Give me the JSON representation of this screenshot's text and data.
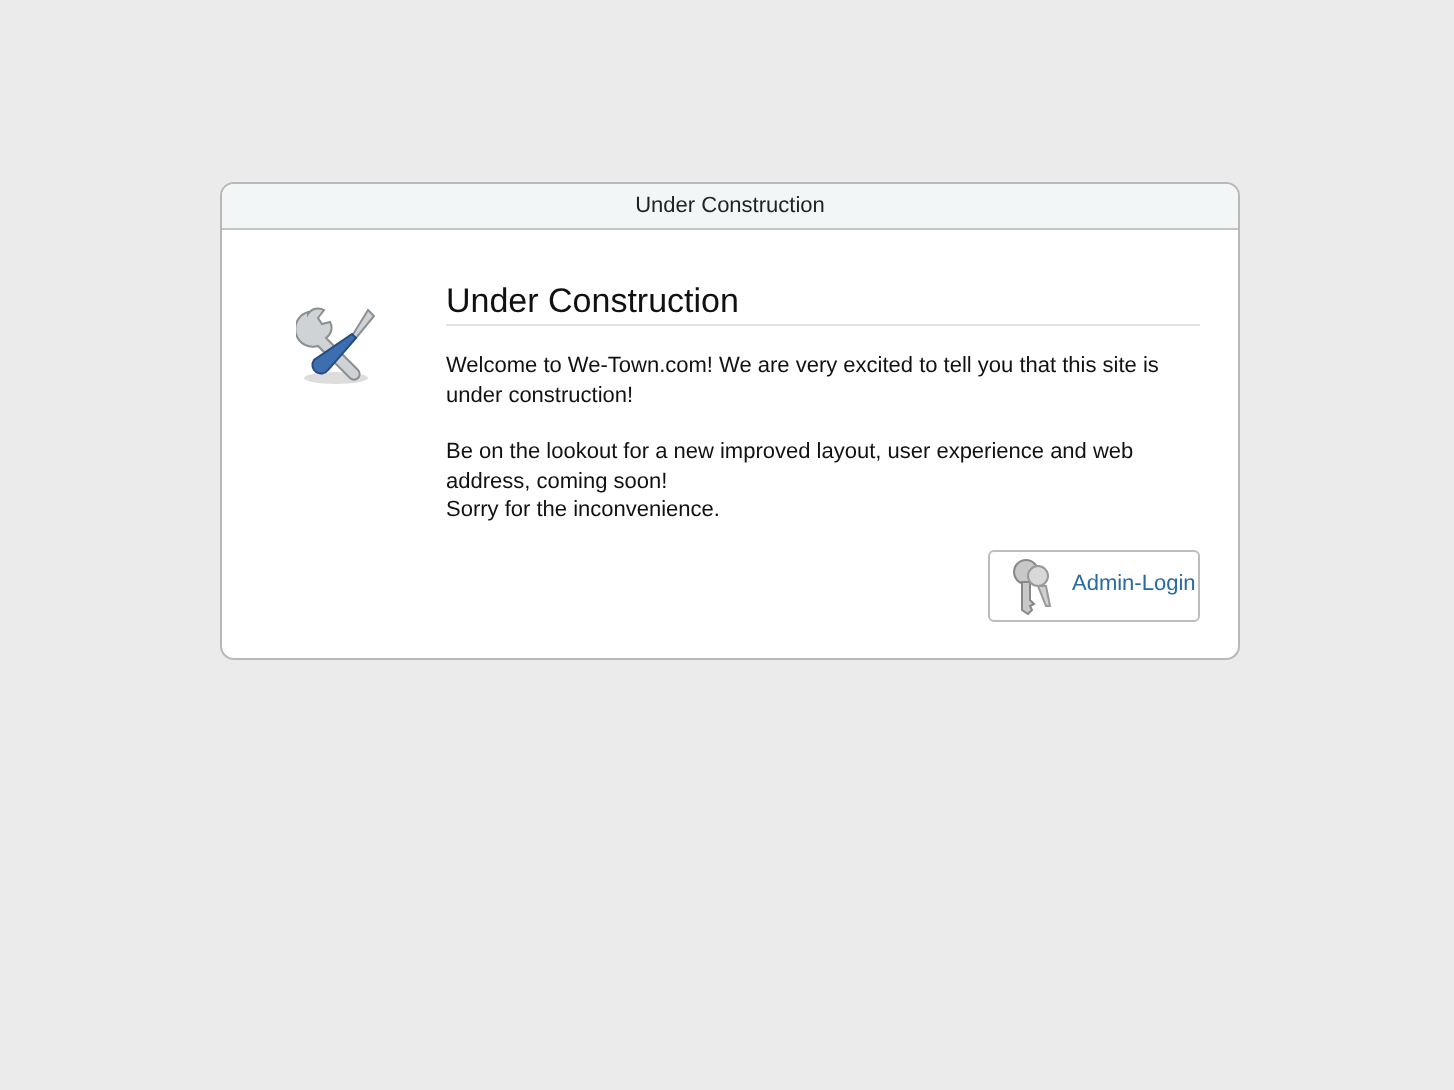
{
  "window": {
    "title": "Under Construction"
  },
  "content": {
    "heading": "Under Construction",
    "paragraphs": [
      [
        "Welcome to We-Town.com! We are very excited to tell you that this site is under construction!"
      ],
      [
        "Be on the lookout for a new improved layout, user experience and web address, coming soon!",
        "Sorry for the inconvenience."
      ]
    ]
  },
  "button": {
    "label": "Admin-Login"
  }
}
